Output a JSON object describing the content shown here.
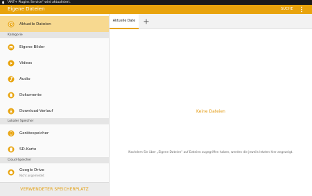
{
  "status_bar": {
    "notification": "\"ANT+ Plugins Service\" wird aktualisiert."
  },
  "app_bar": {
    "title": "Eigene Dateien",
    "search_label": "SUCHE",
    "more_icon": "more-vert-icon"
  },
  "sidebar": {
    "recent": {
      "label": "Aktuelle Dateien",
      "icon": "clock-icon",
      "active": true
    },
    "sections": {
      "category": "Kategorie",
      "local": "Lokaler Speicher",
      "cloud": "Cloud-Speicher"
    },
    "category_items": [
      {
        "label": "Eigene Bilder",
        "icon": "image-icon"
      },
      {
        "label": "Videos",
        "icon": "video-icon"
      },
      {
        "label": "Audio",
        "icon": "audio-icon"
      },
      {
        "label": "Dokumente",
        "icon": "document-icon"
      },
      {
        "label": "Download-Verlauf",
        "icon": "download-icon"
      }
    ],
    "local_items": [
      {
        "label": "Gerätespeicher",
        "icon": "device-storage-icon"
      },
      {
        "label": "SD-Karte",
        "icon": "sd-card-icon"
      }
    ],
    "cloud_items": [
      {
        "label": "Google Drive",
        "sublabel": "Nicht angemeldet",
        "icon": "google-drive-icon"
      }
    ],
    "footer_label": "VERWENDETER SPEICHERPLATZ"
  },
  "tabs": [
    {
      "label": "Aktuelle Date",
      "active": true
    }
  ],
  "add_tab_icon": "plus-icon",
  "content": {
    "empty_title": "Keine Dateien",
    "empty_hint": "Nachdem Sie über „Eigene Dateien\" auf Dateien zugegriffen haben, werden die jeweils letzten hier angezeigt."
  },
  "colors": {
    "accent": "#e8a30c",
    "active_bg": "#f7d990",
    "status_bar": "#1a1a1a"
  }
}
